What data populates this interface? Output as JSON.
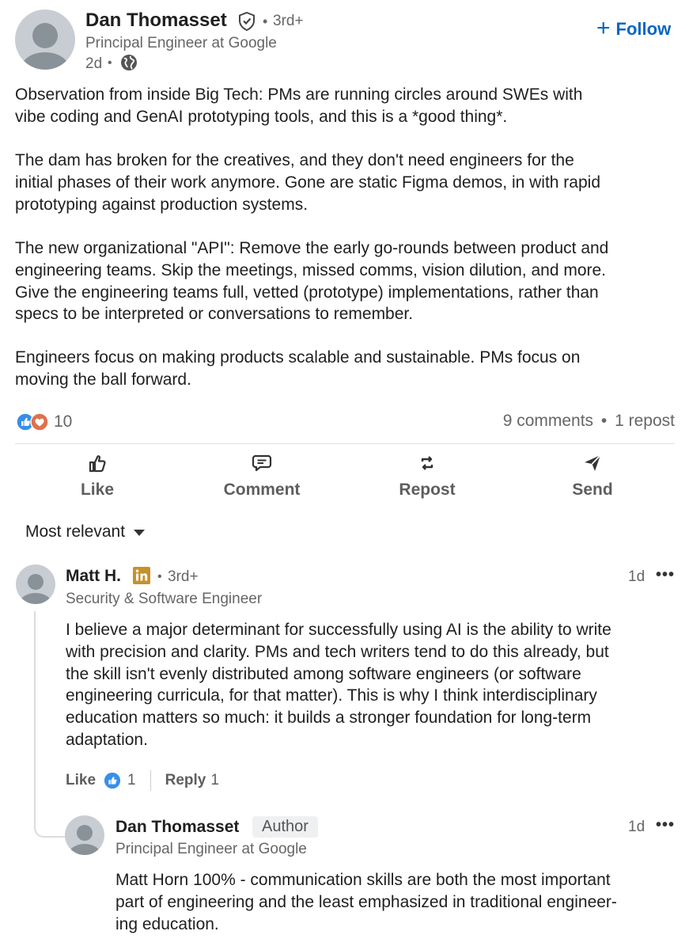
{
  "post": {
    "author": {
      "name": "Dan Thomasset",
      "degree": "3rd+",
      "headline": "Principal Engineer at Google",
      "time": "2d"
    },
    "follow_label": "Follow",
    "paragraphs": [
      [
        "Observation from inside Big Tech:  PMs are running circles around SWEs with",
        "vibe coding and GenAI prototyping tools, and this is a *good thing*."
      ],
      [
        "The dam has broken for the creatives, and they don't need engineers for the",
        "initial phases of their work anymore.  Gone are static Figma demos, in with rapid",
        "prototyping against production systems."
      ],
      [
        "The new organizational \"API\":  Remove the early go-rounds between product and",
        "engineering teams.  Skip the meetings, missed comms, vision dilution, and more.",
        "Give the engineering teams full, vetted (prototype) implementations, rather than",
        "specs to be interpreted or conversations to remember."
      ],
      [
        "Engineers focus on making products scalable and sustainable.  PMs focus on",
        "moving the ball forward."
      ]
    ],
    "reactions_count": "10",
    "comments_count": "9 comments",
    "reposts_count": "1 repost",
    "actions": {
      "like": "Like",
      "comment": "Comment",
      "repost": "Repost",
      "send": "Send"
    }
  },
  "sort_label": "Most relevant",
  "comments": [
    {
      "name": "Matt H.",
      "degree": "3rd+",
      "headline": "Security & Software Engineer",
      "time": "1d",
      "lines": [
        "I believe a major determinant for successfully using AI is the ability to write",
        "with precision and clarity. PMs and tech writers tend to do this already, but",
        "the skill isn't evenly distributed among software engineers (or software",
        "engineering curricula, for that matter). This is why I think interdisciplinary",
        "education matters so much: it builds a stronger foundation for long-term",
        "adaptation."
      ],
      "like_label": "Like",
      "like_count": "1",
      "reply_label": "Reply",
      "reply_count": "1"
    }
  ],
  "reply": {
    "name": "Dan Thomasset",
    "badge": "Author",
    "headline": "Principal Engineer at Google",
    "time": "1d",
    "lines": [
      "Matt Horn 100% - communication skills are both the most important",
      "part of engineering and the least emphasized in traditional engineer-",
      "ing education."
    ]
  },
  "colors": {
    "link_blue": "#0a66c2",
    "gray_text": "#666666",
    "author_badge_bg": "#eef0f2",
    "linkedin_gold": "#c6912c"
  }
}
